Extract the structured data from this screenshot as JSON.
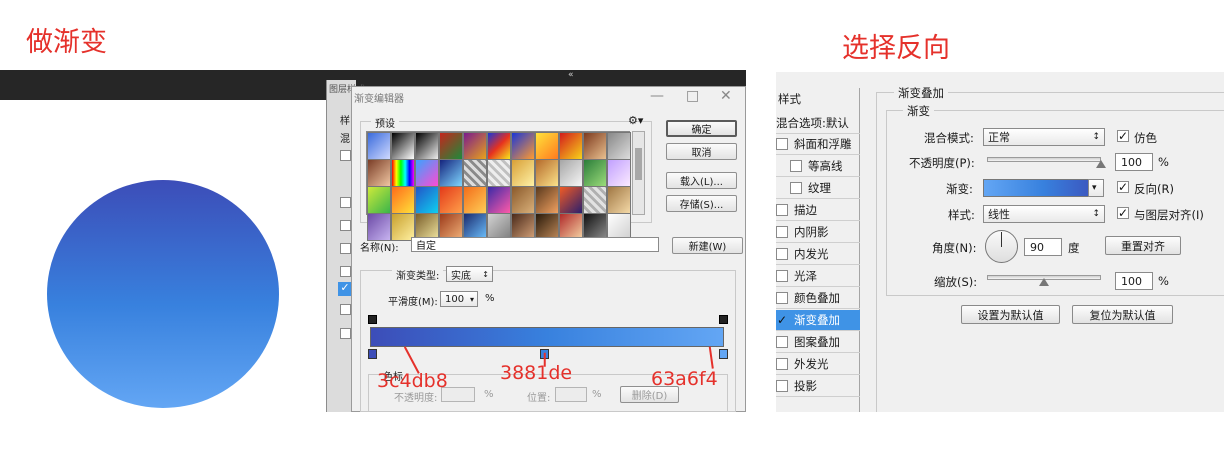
{
  "captions": {
    "left": "做渐变",
    "right": "选择反向"
  },
  "colors": {
    "stop1": "#3c4db8",
    "stop2": "#3881de",
    "stop3": "#63a6f4",
    "caption": "#e5312b",
    "selected": "#3f93e6"
  },
  "layers_panel": {
    "header": "图层样式",
    "item1": "样",
    "item2": "混"
  },
  "dialog": {
    "title": "渐变编辑器",
    "presets_label": "预设",
    "gear_icon": "gear-icon",
    "buttons": {
      "ok": "确定",
      "cancel": "取消",
      "load": "载入(L)...",
      "save": "存储(S)..."
    },
    "name_label": "名称(N):",
    "name_value": "自定",
    "new_button": "新建(W)",
    "gradient_type_label": "渐变类型:",
    "gradient_type_value": "实底",
    "smoothness_label": "平滑度(M):",
    "smoothness_value": "100",
    "percent": "%",
    "stops_label": "色标",
    "opacity_label": "不透明度:",
    "location_label": "位置:",
    "delete_button": "删除(D)"
  },
  "annotations": {
    "stop1": "3c4db8",
    "stop2": "3881de",
    "stop3": "63a6f4"
  },
  "right_panel": {
    "sidebar": {
      "header": "样式",
      "blend_options": "混合选项:默认",
      "items": [
        {
          "label": "斜面和浮雕",
          "checked": false
        },
        {
          "label": "等高线",
          "checked": false
        },
        {
          "label": "纹理",
          "checked": false
        },
        {
          "label": "描边",
          "checked": false
        },
        {
          "label": "内阴影",
          "checked": false
        },
        {
          "label": "内发光",
          "checked": false
        },
        {
          "label": "光泽",
          "checked": false
        },
        {
          "label": "颜色叠加",
          "checked": false
        },
        {
          "label": "渐变叠加",
          "checked": true,
          "selected": true
        },
        {
          "label": "图案叠加",
          "checked": false
        },
        {
          "label": "外发光",
          "checked": false
        },
        {
          "label": "投影",
          "checked": false
        }
      ]
    },
    "section_title": "渐变叠加",
    "group_title": "渐变",
    "blend_mode_label": "混合模式:",
    "blend_mode_value": "正常",
    "dither_label": "仿色",
    "opacity_label": "不透明度(P):",
    "opacity_value": "100",
    "opacity_fraction": 1.0,
    "percent": "%",
    "gradient_label": "渐变:",
    "reverse_label": "反向(R)",
    "style_label": "样式:",
    "style_value": "线性",
    "align_label": "与图层对齐(I)",
    "angle_label": "角度(N):",
    "angle_value": "90",
    "degree_unit": "度",
    "reset_align_button": "重置对齐",
    "scale_label": "缩放(S):",
    "scale_value": "100",
    "scale_fraction": 0.5,
    "set_default_button": "设置为默认值",
    "reset_default_button": "复位为默认值"
  }
}
